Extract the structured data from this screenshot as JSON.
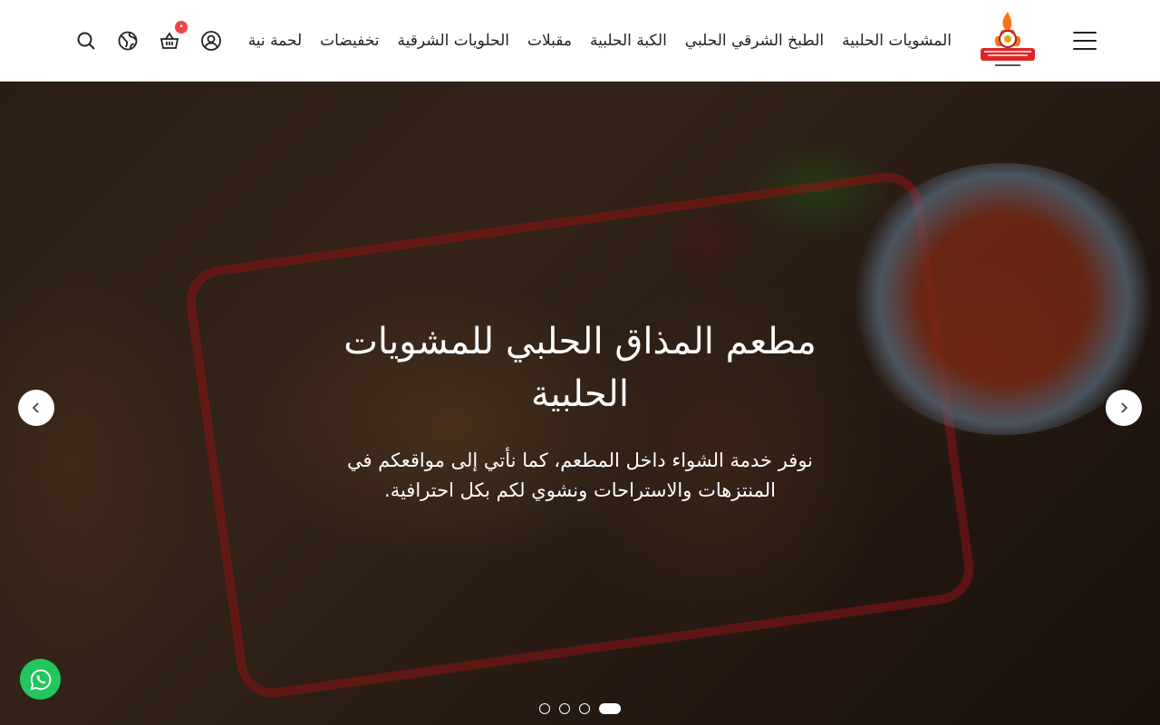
{
  "header": {
    "menu_icon": "hamburger-icon",
    "logo_icon": "restaurant-logo",
    "nav": [
      {
        "label": "المشويات الحلبية"
      },
      {
        "label": "الطبخ الشرقي الحلبي"
      },
      {
        "label": "الكبة الحلبية"
      },
      {
        "label": "مقبلات"
      },
      {
        "label": "الحلويات الشرقية"
      },
      {
        "label": "تخفيضات"
      },
      {
        "label": "لحمة نية"
      }
    ],
    "icons": [
      "search-icon",
      "globe-icon",
      "cart-icon",
      "user-icon"
    ],
    "cart_badge": "•"
  },
  "hero": {
    "title": "مطعم المذاق الحلبي للمشويات الحلبية",
    "subtitle": "نوفر خدمة الشواء داخل المطعم، كما نأتي إلى مواقعكم في المنتزهات والاستراحات ونشوي لكم بكل احترافية.",
    "slide_count": 4,
    "active_slide": 4
  },
  "colors": {
    "accent": "#ef4444",
    "whatsapp": "#22c55e"
  }
}
